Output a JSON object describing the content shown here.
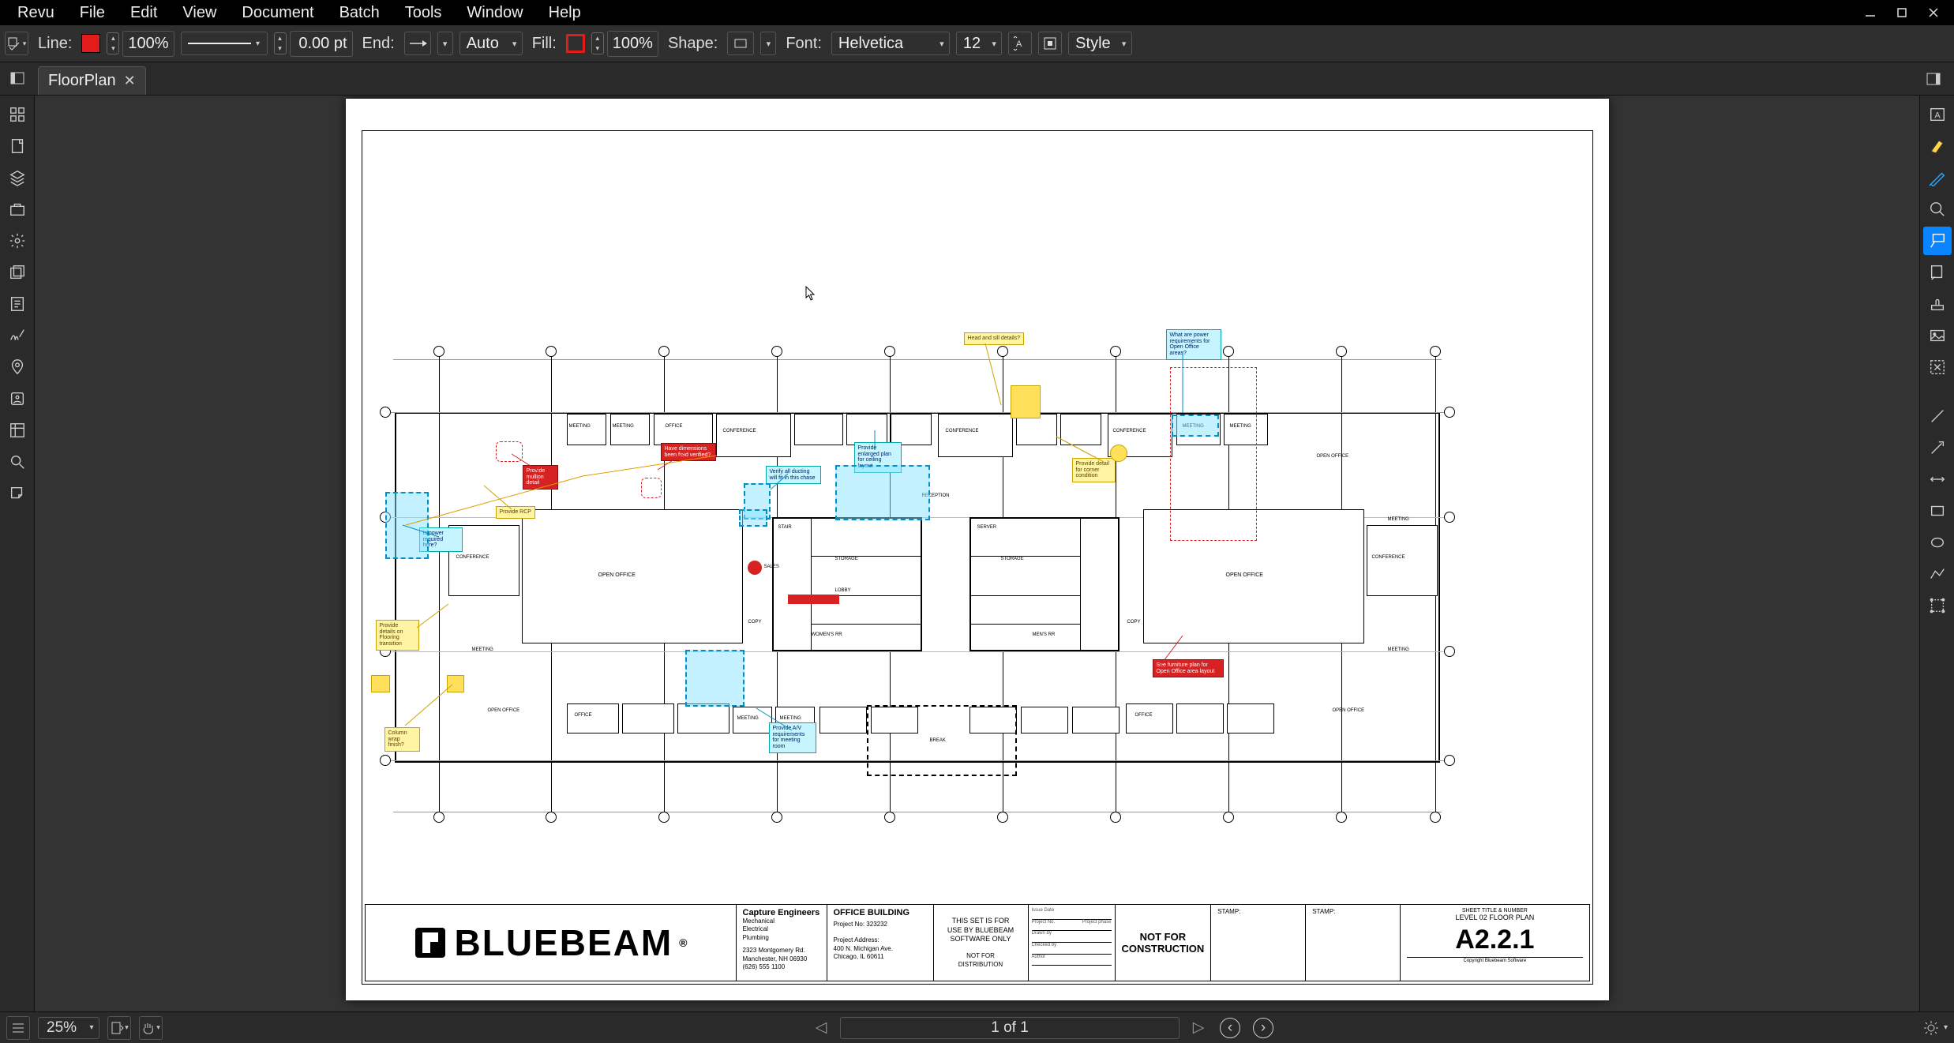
{
  "menu": {
    "items": [
      "Revu",
      "File",
      "Edit",
      "View",
      "Document",
      "Batch",
      "Tools",
      "Window",
      "Help"
    ]
  },
  "propbar": {
    "line_label": "Line:",
    "line_opacity": "100%",
    "line_width": "0.00 pt",
    "end_label": "End:",
    "end_auto": "Auto",
    "fill_label": "Fill:",
    "fill_opacity": "100%",
    "shape_label": "Shape:",
    "font_label": "Font:",
    "font_name": "Helvetica",
    "font_size": "12",
    "style_label": "Style"
  },
  "tab": {
    "name": "FloorPlan"
  },
  "statusbar": {
    "zoom": "25%",
    "page": "1 of 1"
  },
  "titleblock": {
    "brand": "BLUEBEAM",
    "engineers_title": "Capture Engineers",
    "engineers_lines": "Mechanical\nElectrical\nPlumbing",
    "engineers_addr": "2323 Montgomery Rd.\nManchester, NH 06930\n(626) 555 1100",
    "project_title": "OFFICE BUILDING",
    "project_no": "Project No: 323232",
    "project_addr": "Project Address:\n400 N. Michigan Ave.\nChicago, IL 60611",
    "set_note": "THIS SET IS FOR\nUSE BY BLUEBEAM\nSOFTWARE ONLY",
    "dist_note": "NOT FOR\nDISTRIBUTION",
    "notfor": "NOT FOR\nCONSTRUCTION",
    "stamp": "STAMP:",
    "sheet_title_label": "SHEET TITLE & NUMBER",
    "sheet_title": "LEVEL 02 FLOOR PLAN",
    "sheet_no": "A2.2.1",
    "copyright": "Copyright Bluebeam Software"
  },
  "annotations": {
    "head_sill": "Head and sill details?",
    "power": "What are power requirements for Open Office areas?",
    "enlarged": "Provide enlarged plan for ceiling layout",
    "corner": "Provide detail for corner condition",
    "rcp": "Provide RCP",
    "flooring": "Provide details on Flooring transition",
    "column": "Column wrap finish?",
    "verify": "Verify all ducting will fit in this chase",
    "av": "Provide A/V requirements for meeting room",
    "furniture": "See furniture plan for Open Office area layout",
    "powerloc": "Is power required here?",
    "mullion": "Provide mullion detail",
    "dims": "Have dimensions been field verified?"
  },
  "rooms": {
    "meeting": "MEETING",
    "office": "OFFICE",
    "conference": "CONFERENCE",
    "openoffice": "OPEN OFFICE",
    "storage": "STORAGE",
    "lobby": "LOBBY",
    "stair": "STAIR",
    "copy": "COPY",
    "reception": "RECEPTION",
    "break": "BREAK",
    "server": "SERVER",
    "womens": "WOMEN'S RR",
    "mens": "MEN'S RR",
    "sales": "SALES"
  }
}
